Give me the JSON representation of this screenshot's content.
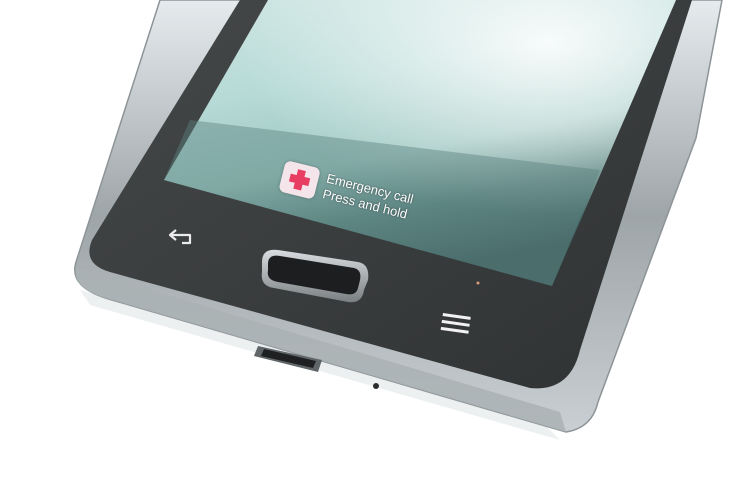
{
  "screen": {
    "emergency_call": {
      "icon": "red-plus-icon",
      "title": "Emergency call",
      "subtitle": "Press and hold"
    }
  },
  "hardware_keys": {
    "back": {
      "icon": "back-arrow-icon"
    },
    "home": {
      "icon": "home-button"
    },
    "menu": {
      "icon": "menu-icon"
    }
  },
  "colors": {
    "bezel": "#3b3d3e",
    "frame": "#b9bfc2",
    "background": "#ffffff",
    "screen_sky": "#d6ece8",
    "screen_grass": "#4a6e6d",
    "emergency_accent": "#e83e62"
  }
}
